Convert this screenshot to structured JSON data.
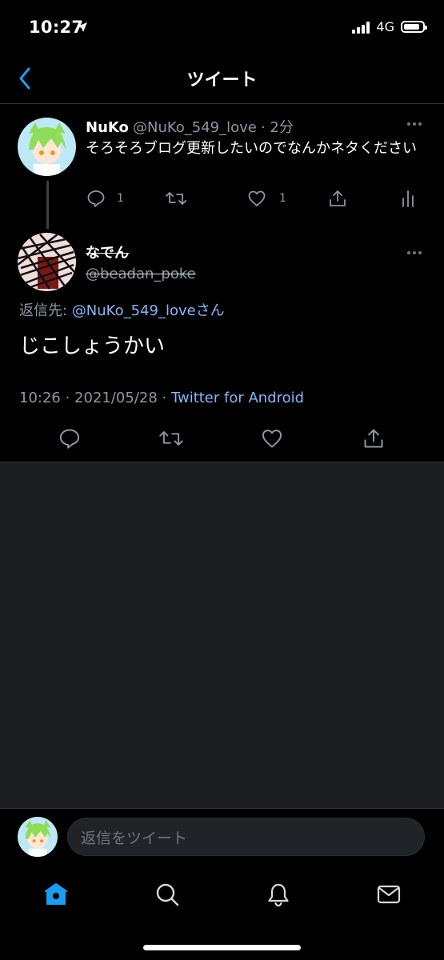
{
  "status_bar": {
    "time": "10:27",
    "network": "4G"
  },
  "header": {
    "title": "ツイート"
  },
  "parent_tweet": {
    "name": "NuKo",
    "handle": "@NuKo_549_love",
    "time_ago": "· 2分",
    "text": "そろそろブログ更新したいのでなんかネタください",
    "reply_count": "1",
    "like_count": "1"
  },
  "main_tweet": {
    "name": "なでん",
    "handle": "@beadan_poke",
    "reply_to_prefix": "返信先: ",
    "reply_to_user": "@NuKo_549_loveさん",
    "text": "じこしょうかい",
    "timestamp": "10:26 · 2021/05/28 · ",
    "source": "Twitter for Android"
  },
  "reply_bar": {
    "placeholder": "返信をツイート"
  },
  "colors": {
    "accent": "#1d9bf0",
    "link": "#8ab4f8",
    "muted": "#8b98a5",
    "background": "#000000",
    "panel": "#1c1d21"
  },
  "tab_bar": {
    "items": [
      "home-icon",
      "search-icon",
      "notifications-icon",
      "messages-icon"
    ],
    "active": "home-icon"
  }
}
